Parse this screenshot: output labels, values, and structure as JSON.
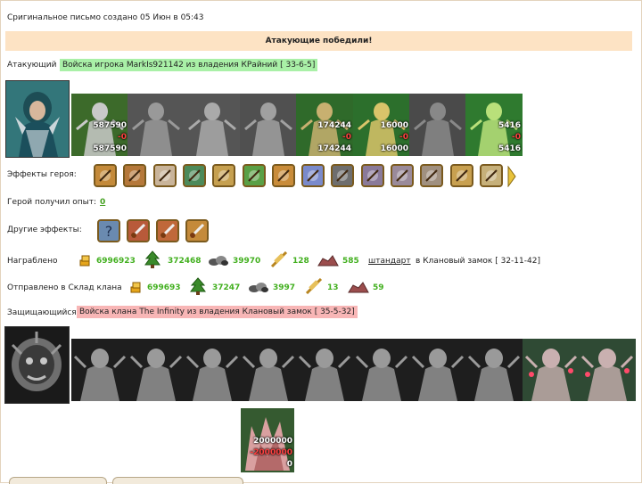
{
  "header": {
    "created_text": "Сригинальное письмо создано 05 Июн в 05:43",
    "banner": "Атакующие победили!"
  },
  "attacker": {
    "label": "Атакующий",
    "army_text": "Войска игрока MarkIs921142 из владения КРайний [ 33-6-5]",
    "units": [
      {
        "name": "hero",
        "top": "",
        "mid": "",
        "bottom": ""
      },
      {
        "name": "unit-1",
        "top": "587590",
        "mid": "-0",
        "bottom": "587590"
      },
      {
        "name": "unit-2",
        "top": "",
        "mid": "",
        "bottom": ""
      },
      {
        "name": "unit-3",
        "top": "",
        "mid": "",
        "bottom": ""
      },
      {
        "name": "unit-4",
        "top": "",
        "mid": "",
        "bottom": ""
      },
      {
        "name": "unit-5",
        "top": "174244",
        "mid": "-0",
        "bottom": "174244"
      },
      {
        "name": "unit-6",
        "top": "16000",
        "mid": "-0",
        "bottom": "16000"
      },
      {
        "name": "unit-7",
        "top": "",
        "mid": "",
        "bottom": ""
      },
      {
        "name": "unit-8",
        "top": "5416",
        "mid": "-0",
        "bottom": "5416"
      }
    ]
  },
  "hero_effects": {
    "label": "Эффекты героя:",
    "icons": [
      "helmet-icon",
      "chest-icon",
      "gift-icon",
      "shield-icon",
      "shield-arm-icon",
      "sword-icon",
      "bow-icon",
      "hand-icon",
      "wolf-icon",
      "star-icon",
      "spider-icon",
      "bird-icon",
      "crossbow-icon",
      "knight-shield-icon"
    ]
  },
  "experience": {
    "label": "Герой получил опыт:",
    "value": "0"
  },
  "other_effects": {
    "label": "Другие эффекты:",
    "icons": [
      "question-icon",
      "sword-up-icon",
      "sword-cross-icon",
      "trophy-icon"
    ]
  },
  "loot": {
    "label": "Награблено",
    "gold": "6996923",
    "wood": "372468",
    "ore": "39970",
    "wheat": "128",
    "stone": "585",
    "link": "штандарт",
    "destination": "в Клановый замок [ 32-11-42]"
  },
  "sent": {
    "label": "Отправлено в Склад клана",
    "gold": "699693",
    "wood": "37247",
    "ore": "3997",
    "wheat": "13",
    "stone": "59"
  },
  "defender": {
    "label": "Защищающийся",
    "army_text": "Войска клана The Infinity из владения Клановый замок [ 35-5-32]",
    "units": [
      {
        "name": "defender-hero"
      },
      {
        "name": "d-unit-1"
      },
      {
        "name": "d-unit-2"
      },
      {
        "name": "d-unit-3"
      },
      {
        "name": "d-unit-4"
      },
      {
        "name": "d-unit-5"
      },
      {
        "name": "d-unit-6"
      },
      {
        "name": "d-unit-7"
      },
      {
        "name": "d-unit-8"
      },
      {
        "name": "d-unit-9"
      },
      {
        "name": "d-unit-10"
      },
      {
        "name": "d-unit-11"
      }
    ],
    "garrison": {
      "top": "2000000",
      "mid": "-2000000",
      "bottom": "0"
    }
  },
  "colors": {
    "banner": "#fde3c4",
    "attacker_tag": "#a9f0a7",
    "defender_tag": "#f8b6b6",
    "resource_value": "#43b020"
  }
}
